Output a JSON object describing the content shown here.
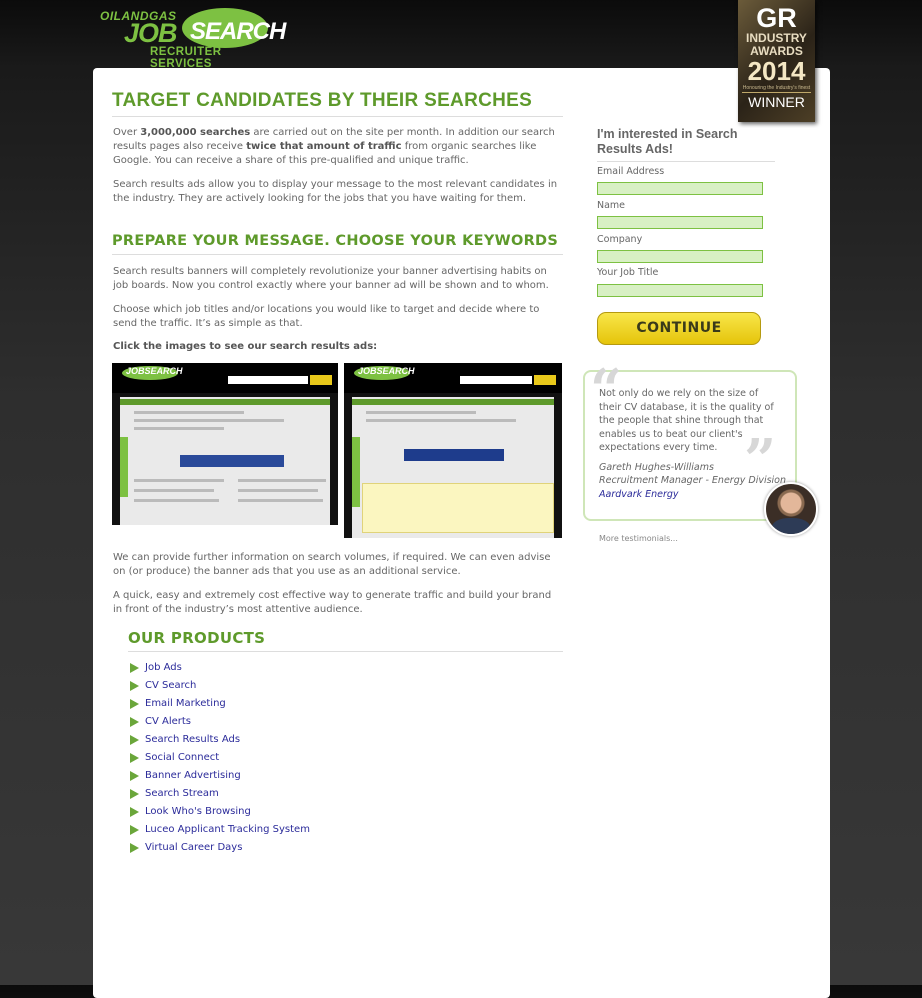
{
  "logo": {
    "line1": "OILANDGAS",
    "line2": "JOB",
    "line3": "SEARCH",
    "line4": "RECRUITER SERVICES"
  },
  "award": {
    "badge": "GR",
    "line1": "INDUSTRY",
    "line2": "AWARDS",
    "year": "2014",
    "subtitle": "Honouring the Industry's finest",
    "result": "WINNER"
  },
  "main": {
    "title": "TARGET CANDIDATES BY THEIR SEARCHES",
    "p1_pre": "Over ",
    "p1_bold1": "3,000,000 searches",
    "p1_mid": " are carried out on the site per month. In addition our search results pages also receive ",
    "p1_bold2": "twice that amount of traffic",
    "p1_post": " from organic searches like Google. You can receive a share of this pre-qualified and unique traffic.",
    "p2": "Search results ads allow you to display your message to the most relevant candidates in the industry. They are actively looking for the jobs that you have waiting for them.",
    "section2_title": "PREPARE YOUR MESSAGE. CHOOSE YOUR KEYWORDS",
    "p3": "Search results banners will completely revolutionize your banner advertising habits on job boards. Now you control exactly where your banner ad will be shown and to whom.",
    "p4": "Choose which job titles and/or locations you would like to target and decide where to send the traffic. It’s as simple as that.",
    "p5": "Click the images to see our search results ads:",
    "thumb1_logo": "JOBSEARCH",
    "thumb2_logo": "JOBSEARCH",
    "p6": "We can provide further information on search volumes, if required. We can even advise on (or produce) the banner ads that you use as an additional service.",
    "p7": "A quick, easy and extremely cost effective way to generate traffic and build your brand in front of the industry’s most attentive audience.",
    "products_title": "OUR PRODUCTS",
    "products": [
      "Job Ads",
      "CV Search",
      "Email Marketing",
      "CV Alerts",
      "Search Results Ads",
      "Social Connect",
      "Banner Advertising",
      "Search Stream",
      "Look Who's Browsing",
      "Luceo Applicant Tracking System",
      "Virtual Career Days"
    ]
  },
  "form": {
    "title": "I'm interested in Search Results Ads!",
    "fields": [
      {
        "label": "Email Address",
        "value": ""
      },
      {
        "label": "Name",
        "value": ""
      },
      {
        "label": "Company",
        "value": ""
      },
      {
        "label": "Your Job Title",
        "value": ""
      }
    ],
    "button": "CONTINUE"
  },
  "testimonial": {
    "quote": "Not only do we rely on the size of their CV database, it is the quality of the people that shine through that enables us to beat our client's expectations every time.",
    "name": "Gareth Hughes-Williams",
    "role": "Recruitment Manager - Energy Division",
    "company": "Aardvark Energy",
    "more": "More testimonials..."
  },
  "colors": {
    "accent_green": "#5e9a2b",
    "link_blue": "#2b2b9a",
    "button_yellow": "#f1d72a"
  }
}
